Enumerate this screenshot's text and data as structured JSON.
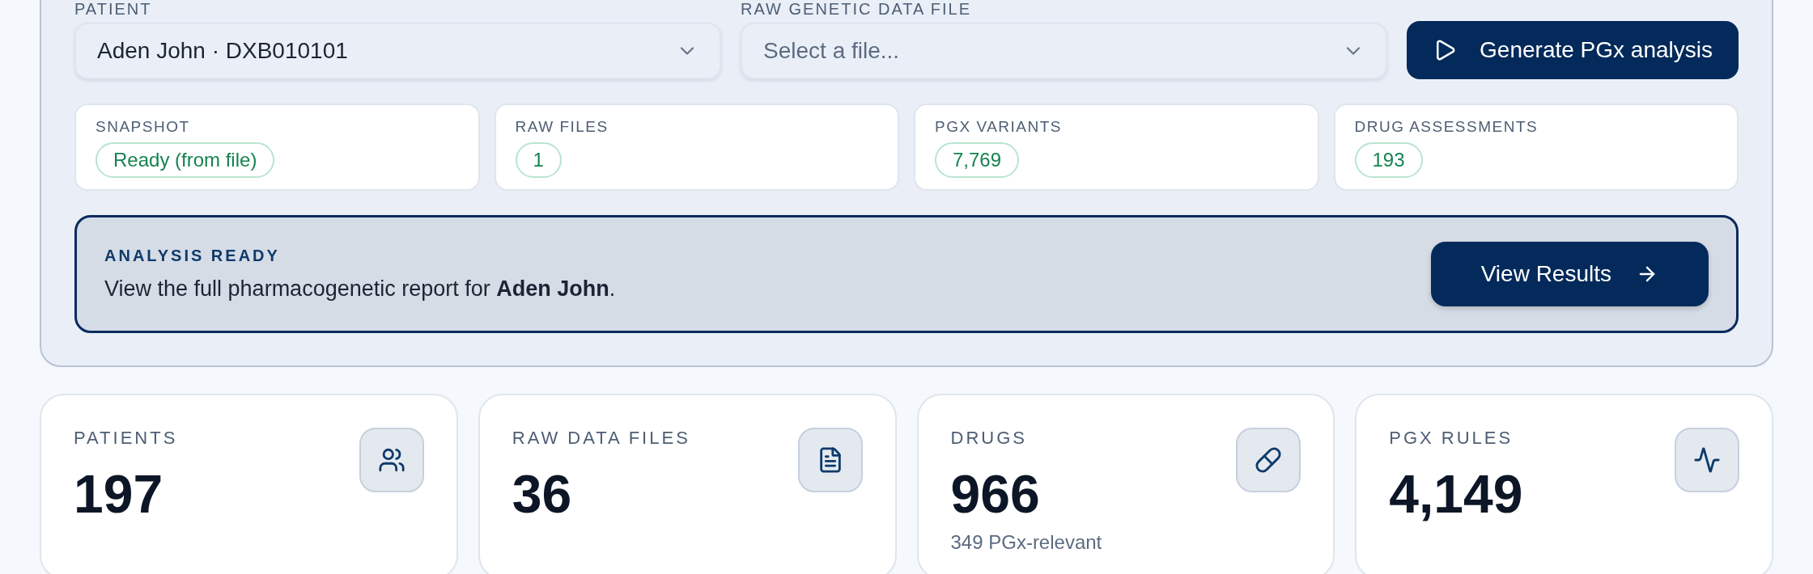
{
  "analysis_panel": {
    "fields": [
      {
        "kind": "select",
        "label": "PATIENT",
        "value": "Aden John · DXB010101"
      },
      {
        "kind": "select",
        "label": "RAW GENETIC DATA FILE",
        "placeholder": "Select a file..."
      }
    ],
    "generate_button": "Generate PGx analysis",
    "summary": [
      {
        "label": "SNAPSHOT",
        "badge": "Ready (from file)"
      },
      {
        "label": "RAW FILES",
        "badge": "1"
      },
      {
        "label": "PGX VARIANTS",
        "badge": "7,769"
      },
      {
        "label": "DRUG ASSESSMENTS",
        "badge": "193"
      }
    ],
    "banner": {
      "title": "ANALYSIS READY",
      "message": "View the full pharmacogenetic report for **Aden John**.",
      "button": "View Results"
    }
  },
  "stats": [
    {
      "kind": "patients",
      "label": "PATIENTS",
      "value": "197"
    },
    {
      "kind": "files",
      "label": "RAW DATA FILES",
      "value": "36"
    },
    {
      "kind": "drugs",
      "label": "DRUGS",
      "value": "966",
      "note": "349 PGx-relevant"
    },
    {
      "kind": "rules",
      "label": "PGX RULES",
      "value": "4,149"
    }
  ]
}
